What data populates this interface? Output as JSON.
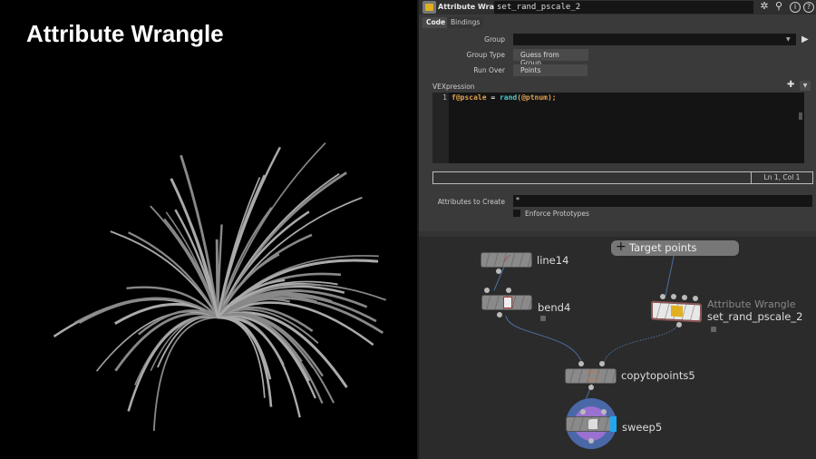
{
  "viewport": {
    "title": "Attribute Wrangle"
  },
  "params": {
    "node_type": "Attribute Wrangle",
    "node_name": "set_rand_pscale_2",
    "toolbar_icons": [
      "gear-icon",
      "search-icon",
      "info-icon",
      "help-icon"
    ],
    "tabs": [
      "Code",
      "Bindings"
    ],
    "group_label": "Group",
    "group_value": "",
    "group_type_label": "Group Type",
    "group_type_value": "Guess from Group",
    "run_over_label": "Run Over",
    "run_over_value": "Points",
    "vex_label": "VEXpression",
    "code": {
      "line": "1",
      "var": "f@pscale",
      "eq": " = ",
      "fn": "rand",
      "args": "(@ptnum);"
    },
    "status_pos": "Ln 1, Col 1",
    "attr_create_label": "Attributes to Create",
    "attr_create_value": "*",
    "enforce_label": "Enforce Prototypes"
  },
  "network": {
    "sticky": "Target points",
    "nodes": {
      "line": "line14",
      "bend": "bend4",
      "wrangle_type": "Attribute Wrangle",
      "wrangle": "set_rand_pscale_2",
      "copy": "copytopoints5",
      "sweep": "sweep5"
    }
  },
  "colors": {
    "accent_blue": "#1fa8f0",
    "sweep_purple": "#9a70d0",
    "wire": "#4a70a0"
  }
}
